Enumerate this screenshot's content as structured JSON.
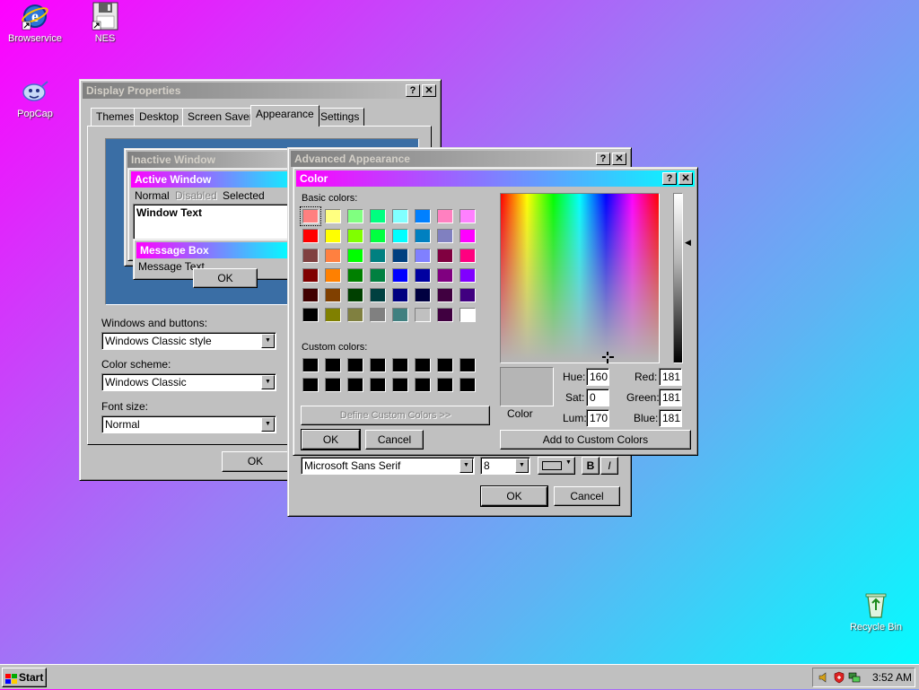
{
  "desktop": {
    "icons": [
      {
        "label": "Browservice",
        "icon": "internet-explorer-icon"
      },
      {
        "label": "NES",
        "icon": "floppy-disk-icon"
      },
      {
        "label": "PopCap",
        "icon": "popcap-icon"
      },
      {
        "label": "Recycle Bin",
        "icon": "recycle-bin-icon"
      }
    ]
  },
  "display_properties": {
    "title": "Display Properties",
    "tabs": [
      {
        "label": "Themes"
      },
      {
        "label": "Desktop"
      },
      {
        "label": "Screen Saver"
      },
      {
        "label": "Appearance"
      },
      {
        "label": "Settings"
      }
    ],
    "selected_tab": "Appearance",
    "preview": {
      "inactive_title": "Inactive Window",
      "active_title": "Active Window",
      "menu_normal": "Normal",
      "menu_disabled": "Disabled",
      "menu_selected": "Selected",
      "window_text": "Window Text",
      "message_box_title": "Message Box",
      "message_text": "Message Text",
      "ok_label": "OK"
    },
    "windows_and_buttons_label": "Windows and buttons:",
    "windows_and_buttons_value": "Windows Classic style",
    "color_scheme_label": "Color scheme:",
    "color_scheme_value": "Windows Classic",
    "font_size_label": "Font size:",
    "font_size_value": "Normal",
    "ok_label": "OK"
  },
  "advanced_appearance": {
    "title": "Advanced Appearance",
    "font_value": "Microsoft Sans Serif",
    "size_value": "8",
    "bold_label": "B",
    "italic_label": "I",
    "ok_label": "OK",
    "cancel_label": "Cancel"
  },
  "color_dialog": {
    "title": "Color",
    "basic_colors_label": "Basic colors:",
    "basic_colors": [
      "#ff8080",
      "#ffff80",
      "#80ff80",
      "#00ff80",
      "#80ffff",
      "#0080ff",
      "#ff80c0",
      "#ff80ff",
      "#ff0000",
      "#ffff00",
      "#80ff00",
      "#00ff40",
      "#00ffff",
      "#0080c0",
      "#8080c0",
      "#ff00ff",
      "#804040",
      "#ff8040",
      "#00ff00",
      "#008080",
      "#004080",
      "#8080ff",
      "#800040",
      "#ff0080",
      "#800000",
      "#ff8000",
      "#008000",
      "#008040",
      "#0000ff",
      "#0000a0",
      "#800080",
      "#8000ff",
      "#400000",
      "#804000",
      "#004000",
      "#004040",
      "#000080",
      "#000040",
      "#400040",
      "#400080",
      "#000000",
      "#808000",
      "#808040",
      "#808080",
      "#408080",
      "#c0c0c0",
      "#400040",
      "#ffffff"
    ],
    "selected_basic_index": 0,
    "custom_colors_label": "Custom colors:",
    "custom_colors": [
      "#000000",
      "#000000",
      "#000000",
      "#000000",
      "#000000",
      "#000000",
      "#000000",
      "#000000",
      "#000000",
      "#000000",
      "#000000",
      "#000000",
      "#000000",
      "#000000",
      "#000000",
      "#000000"
    ],
    "define_custom_label": "Define Custom Colors >>",
    "ok_label": "OK",
    "cancel_label": "Cancel",
    "preview_label": "Color",
    "preview_color": "#b5b5b5",
    "hue_label": "Hue:",
    "hue_value": "160",
    "sat_label": "Sat:",
    "sat_value": "0",
    "lum_label": "Lum:",
    "lum_value": "170",
    "red_label": "Red:",
    "red_value": "181",
    "green_label": "Green:",
    "green_value": "181",
    "blue_label": "Blue:",
    "blue_value": "181",
    "add_custom_label": "Add to Custom Colors"
  },
  "taskbar": {
    "start_label": "Start",
    "tray_icons": [
      "speaker-icon",
      "shield-icon",
      "network-icon"
    ],
    "clock": "3:52 AM"
  },
  "colors": {
    "active_title_start": "#ff00ff",
    "active_title_end": "#00ffff",
    "face": "#c0c0c0",
    "preview_desktop": "#3a6ea5"
  }
}
